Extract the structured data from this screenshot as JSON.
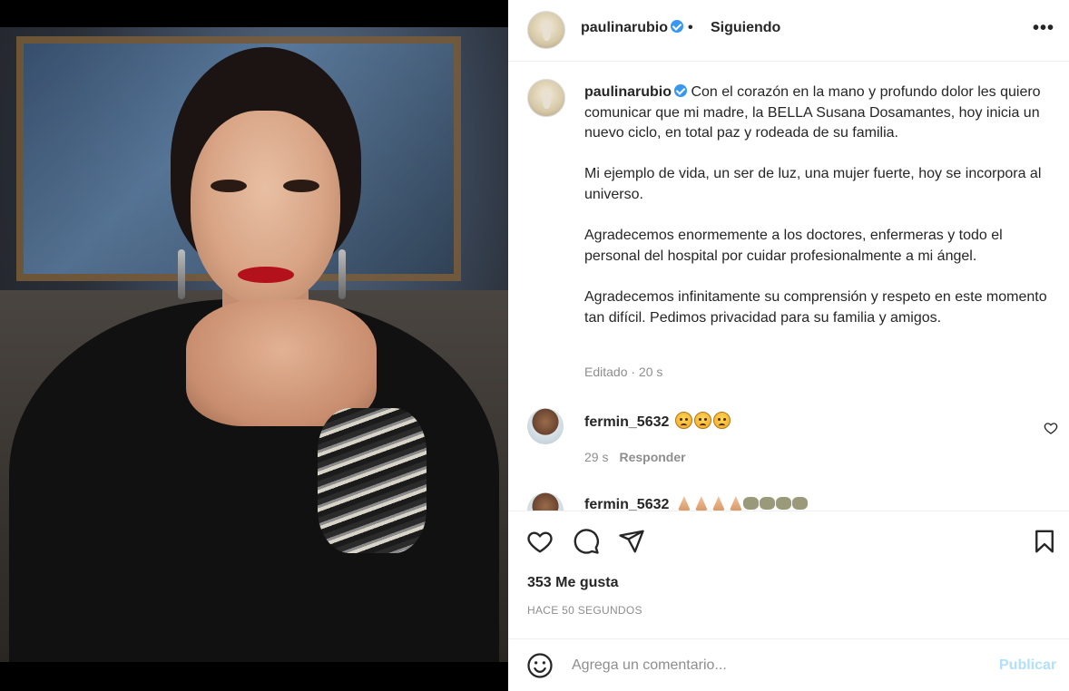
{
  "post": {
    "username": "paulinarubio",
    "verified": true,
    "follow_separator": "•",
    "follow_status": "Siguiendo",
    "more_icon": "more-horizontal-icon",
    "caption": "Con el corazón en la mano y profundo dolor les quiero comunicar que mi madre, la BELLA Susana Dosamantes, hoy inicia un nuevo ciclo, en total paz y rodeada de su familia.\n\nMi ejemplo de vida, un ser de luz, una mujer fuerte, hoy se incorpora al universo.\n\nAgradecemos enormemente a los doctores, enfermeras y todo el personal del hospital por cuidar profesionalmente a mi ángel.\n\nAgradecemos infinitamente su comprensión y respeto en este momento tan difícil. Pedimos privacidad para su familia y amigos.",
    "caption_meta": "Editado · 20 s"
  },
  "comments": [
    {
      "username": "fermin_5632",
      "text": "",
      "emojis": [
        "sad-face",
        "sad-face",
        "sad-face"
      ],
      "time": "29 s",
      "reply_label": "Responder"
    },
    {
      "username": "fermin_5632",
      "text": "",
      "emojis": [
        "praying-hands",
        "praying-hands",
        "praying-hands",
        "praying-hands",
        "heart",
        "heart",
        "heart",
        "heart"
      ]
    }
  ],
  "actions": {
    "like_icon": "heart-icon",
    "comment_icon": "comment-icon",
    "share_icon": "send-icon",
    "save_icon": "bookmark-icon",
    "likes": "353 Me gusta",
    "timestamp": "HACE 50 SEGUNDOS"
  },
  "add_comment": {
    "emoji_icon": "smile-icon",
    "placeholder": "Agrega un comentario...",
    "publish_label": "Publicar"
  },
  "colors": {
    "verified": "#3897f0",
    "publish_disabled": "#b2dffc",
    "muted": "#8e8e8e"
  }
}
